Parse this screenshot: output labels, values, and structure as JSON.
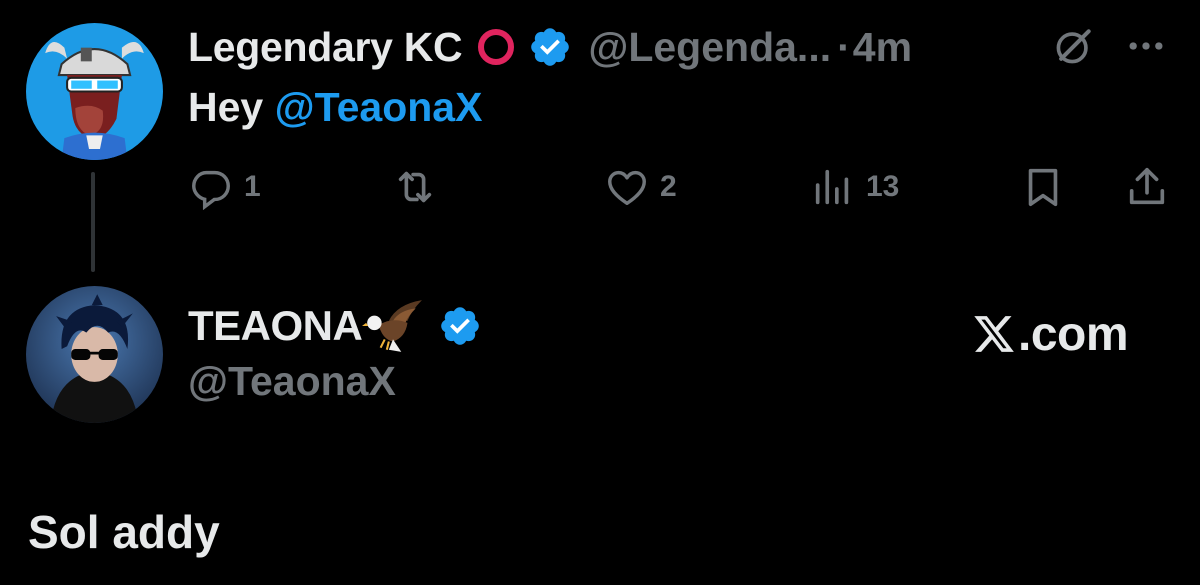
{
  "colors": {
    "background": "#000000",
    "text_primary": "#e7e9ea",
    "text_secondary": "#71767b",
    "accent_blue": "#1d9bf0",
    "red_circle": "#e0245e"
  },
  "tweet1": {
    "display_name": "Legendary KC",
    "name_emoji_icon": "red-circle-icon",
    "handle": "@Legenda...",
    "separator": "·",
    "time": "4m",
    "text_prefix": "Hey ",
    "mention": "@TeaonaX",
    "actions": {
      "reply_count": "1",
      "retweet_count": "",
      "like_count": "2",
      "views_count": "13"
    }
  },
  "tweet2": {
    "display_name": "TEAONA",
    "name_emoji_icon": "eagle-icon",
    "handle": "@TeaonaX",
    "text": "Sol addy",
    "watermark": ".com"
  }
}
